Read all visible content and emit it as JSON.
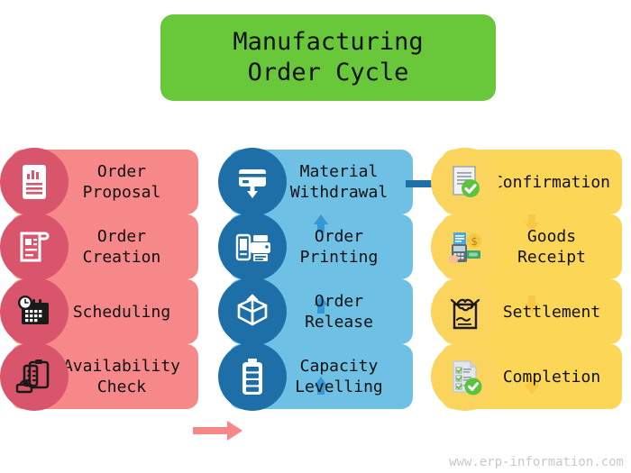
{
  "title": {
    "line1": "Manufacturing",
    "line2": "Order Cycle",
    "background": "#68C83A"
  },
  "watermark": "www.erp-information.com",
  "theme": {
    "left_box": "#F6888A",
    "left_bubble": "#D9556B",
    "mid_box": "#6EC1E4",
    "mid_bubble": "#1E6FA8",
    "right_box": "#FCD757",
    "right_bubble": "#FBD45E",
    "right_arrow": "#FBC846"
  },
  "columns": [
    {
      "id": "left",
      "flow": "top-to-bottom",
      "arrow_color": "#F6888A",
      "nodes": [
        {
          "label": "Order\nProposal",
          "icon": "document-chart-icon"
        },
        {
          "label": "Order\nCreation",
          "icon": "document-scroll-icon"
        },
        {
          "label": "Scheduling",
          "icon": "calendar-clock-icon"
        },
        {
          "label": "Availability\nCheck",
          "icon": "clipboard-inventory-icon"
        }
      ]
    },
    {
      "id": "middle",
      "flow": "bottom-to-top",
      "arrow_color": "#3498D8",
      "nodes": [
        {
          "label": "Material\nWithdrawal",
          "icon": "card-download-icon"
        },
        {
          "label": "Order\nPrinting",
          "icon": "printer-mobile-icon"
        },
        {
          "label": "Order\nRelease",
          "icon": "open-box-arrow-icon"
        },
        {
          "label": "Capacity\nLevelling",
          "icon": "battery-level-icon"
        }
      ]
    },
    {
      "id": "right",
      "flow": "top-to-bottom",
      "arrow_color": "#FBC846",
      "nodes": [
        {
          "label": "Confirmation",
          "icon": "document-check-icon"
        },
        {
          "label": "Goods\nReceipt",
          "icon": "payment-terminal-icon"
        },
        {
          "label": "Settlement",
          "icon": "handshake-contract-icon"
        },
        {
          "label": "Completion",
          "icon": "checklist-done-icon"
        }
      ]
    }
  ],
  "connectors": [
    {
      "from": "Availability Check",
      "to": "Capacity Levelling",
      "direction": "right",
      "color": "#F6888A"
    },
    {
      "from": "Material Withdrawal",
      "to": "Confirmation",
      "direction": "right",
      "color": "#1E6FA8"
    }
  ]
}
